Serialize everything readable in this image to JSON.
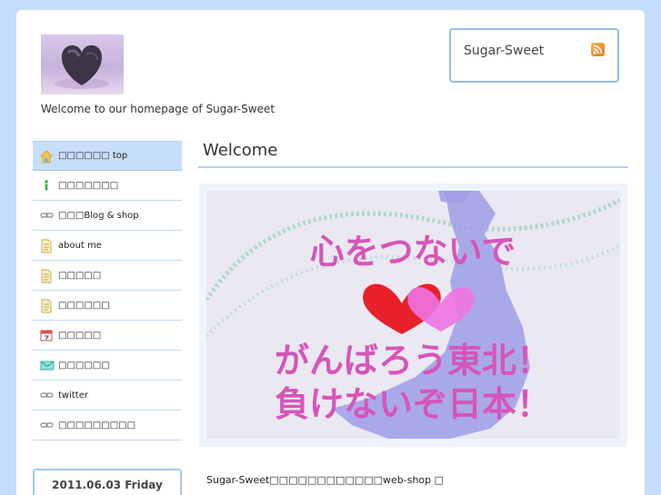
{
  "site": {
    "tagline": "Welcome to our homepage of Sugar-Sweet"
  },
  "rss": {
    "site_name": "Sugar-Sweet",
    "icon": "rss-icon"
  },
  "nav": {
    "items": [
      {
        "label": "□□□□□□ top",
        "icon": "home-icon"
      },
      {
        "label": "□□□□□□□",
        "icon": "info-icon"
      },
      {
        "label": "□□□Blog & shop",
        "icon": "link-icon"
      },
      {
        "label": "about me",
        "icon": "document-icon"
      },
      {
        "label": "□□□□□",
        "icon": "document-icon"
      },
      {
        "label": "□□□□□□",
        "icon": "document-icon"
      },
      {
        "label": "□□□□□",
        "icon": "calendar-icon"
      },
      {
        "label": "□□□□□□",
        "icon": "mail-icon"
      },
      {
        "label": "twitter",
        "icon": "link-icon"
      },
      {
        "label": "□□□□□□□□□",
        "icon": "link-icon"
      }
    ]
  },
  "date": "2011.06.03 Friday",
  "content": {
    "title": "Welcome",
    "banner": {
      "line1": "心をつないで",
      "line2": "がんばろう東北！",
      "line3": "負けないぞ日本！"
    },
    "intro": "Sugar-Sweet□□□□□□□□□□□□web-shop □"
  },
  "colors": {
    "page_background": "#c5dcfa",
    "accent_border": "#92bde7",
    "active_nav": "#c8dffa",
    "banner_text": "#d655b8",
    "heart_red": "#e8202a",
    "heart_pink": "#ee74e3"
  }
}
